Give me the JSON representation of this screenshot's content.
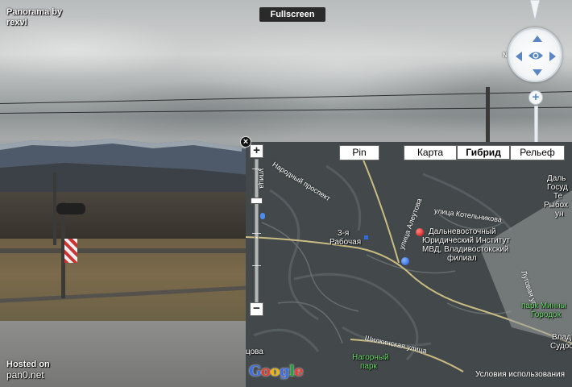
{
  "watermark": {
    "top_line1": "Panorama by",
    "top_line2": "rexvl",
    "bottom_line1": "Hosted on",
    "bottom_line2": "pan0.net"
  },
  "toolbar": {
    "fullscreen_label": "Fullscreen"
  },
  "pano_nav": {
    "north_label": "N",
    "zoom_in_label": "+",
    "zoom_out_label": "−",
    "icons": [
      "north-pointer-icon",
      "pan-up-icon",
      "pan-down-icon",
      "pan-left-icon",
      "pan-right-icon",
      "eye-icon"
    ]
  },
  "map": {
    "close_label": "×",
    "zoom_in_label": "+",
    "zoom_out_label": "−",
    "pin_label": "Pin",
    "map_types": [
      {
        "label": "Карта",
        "active": false
      },
      {
        "label": "Гибрид",
        "active": true
      },
      {
        "label": "Рельеф",
        "active": false
      }
    ],
    "labels": {
      "narodny": "Народный проспект",
      "rabochaya3": "3-я",
      "rabochaya": "Рабочая",
      "ulitsa_a": "улица Алеутова",
      "kotelnikova": "улица Котельникова",
      "poi1": "Дальневосточный",
      "poi2": "Юридический Институт",
      "poi3": "МВД, Владивостокский",
      "poi4": "филиал",
      "right1": "Даль",
      "right2": "Госуд",
      "right3": "Те",
      "right4": "Рыбох",
      "right5": "ун",
      "lugovaya": "Луговая ул.",
      "park_minny1": "парк Минны",
      "park_minny2": "Городок",
      "vlad": "Влад",
      "suds": "Судос",
      "shilkinskaya": "Шилкинская улица",
      "nagorny1": "Нагорный",
      "nagorny2": "парк",
      "tsova": "цова",
      "ulitsa_left": "улица"
    },
    "google_logo": "Google",
    "terms": "Условия использования",
    "colors": {
      "red_marker": "#d00000",
      "blue_marker": "#1e56d6",
      "park_label": "#6fdc6f"
    }
  }
}
